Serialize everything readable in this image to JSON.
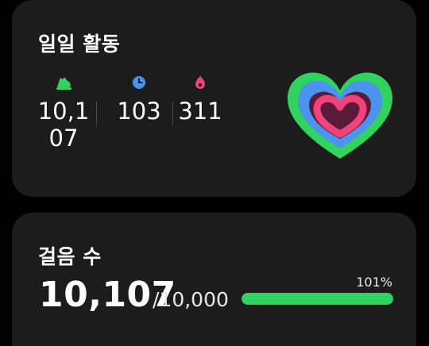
{
  "activity": {
    "title": "일일 활동",
    "metrics": [
      {
        "icon": "shoe-icon",
        "value": "10,107",
        "color": "#2fd35e"
      },
      {
        "icon": "clock-icon",
        "value": "103",
        "color": "#4b93ef"
      },
      {
        "icon": "flame-icon",
        "value": "311",
        "color": "#f0427b"
      }
    ],
    "heart_colors": {
      "outer": "#2fd35e",
      "middle": "#4b93ef",
      "inner": "#f0427b"
    }
  },
  "steps": {
    "title": "걸음 수",
    "value": "10,107",
    "goal": "/10,000",
    "percent_label": "101%",
    "progress": 1.0,
    "bar_color": "#2fd35e"
  }
}
